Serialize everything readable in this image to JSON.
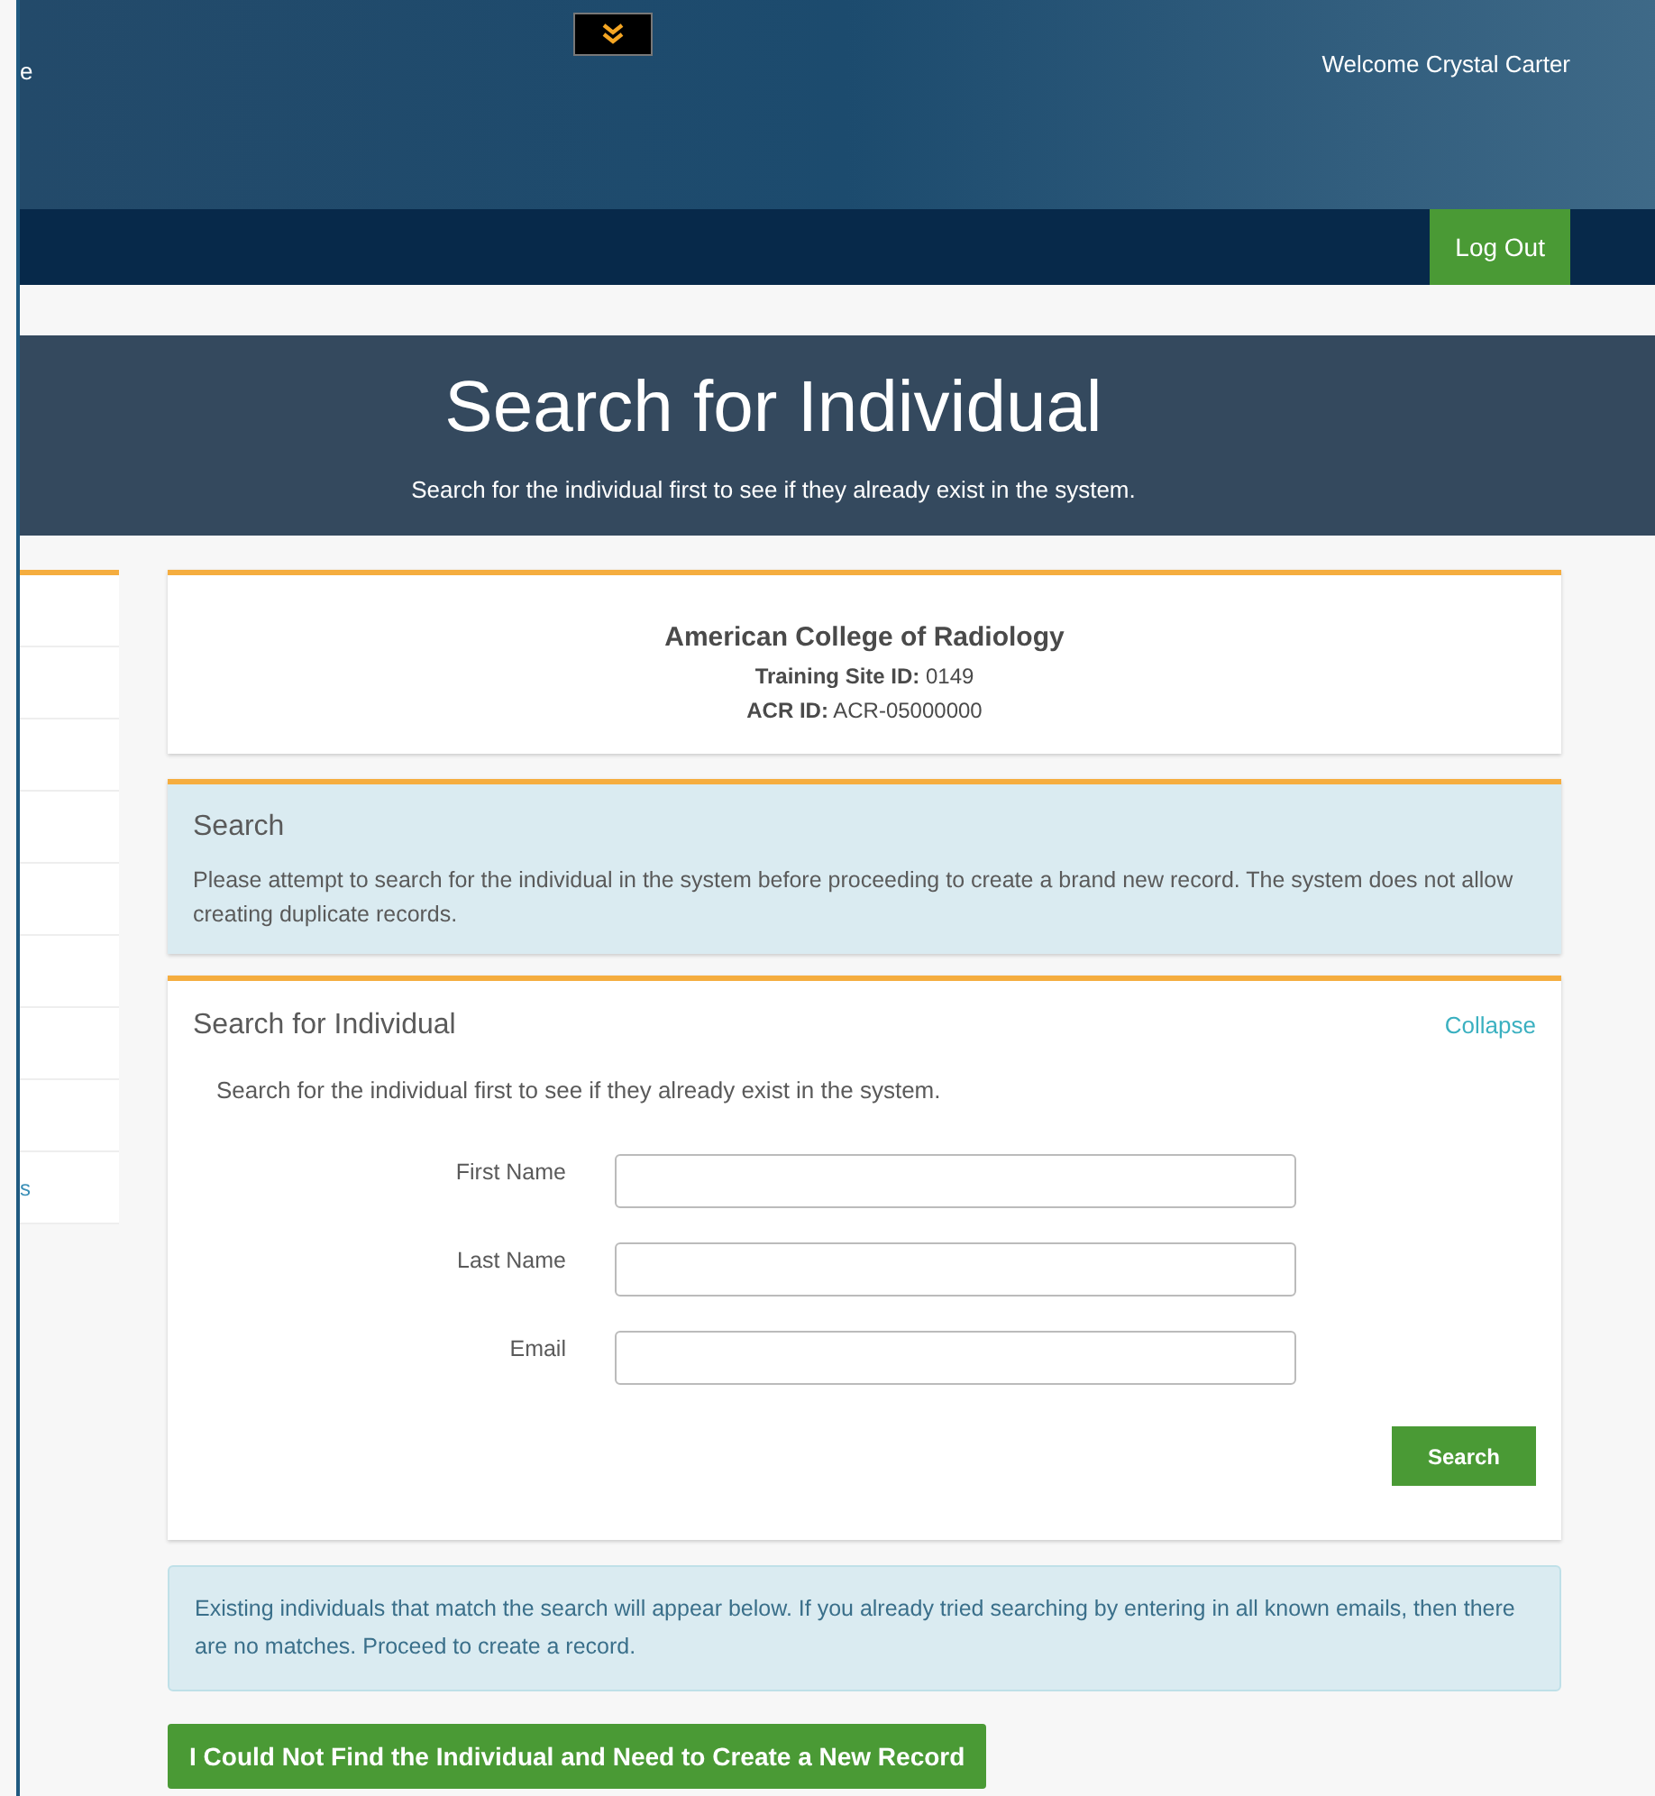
{
  "header": {
    "cut_text": "e",
    "welcome": "Welcome Crystal Carter"
  },
  "nav": {
    "logout": "Log Out"
  },
  "banner": {
    "title": "Search for Individual",
    "subtitle": "Search for the individual first to see if they already exist in the system."
  },
  "sidebar": {
    "cut_text": "s"
  },
  "org_card": {
    "name": "American College of Radiology",
    "lines": [
      {
        "label": "Training Site ID:",
        "value": "0149"
      },
      {
        "label": "ACR ID:",
        "value": "ACR-05000000"
      }
    ]
  },
  "info_panel": {
    "title": "Search",
    "text": "Please attempt to search for the individual in the system before proceeding to create a brand new record. The system does not allow creating duplicate records."
  },
  "search_panel": {
    "title": "Search for Individual",
    "collapse": "Collapse",
    "intro": "Search for the individual first to see if they already exist in the system.",
    "fields": [
      {
        "label": "First Name"
      },
      {
        "label": "Last Name"
      },
      {
        "label": "Email"
      }
    ],
    "button": "Search"
  },
  "results_note": "Existing individuals that match the search will appear below. If you already tried searching by entering in all known emails, then there are no matches. Proceed to create a record.",
  "create_button": "I Could Not Find the Individual and Need to Create a New Record"
}
